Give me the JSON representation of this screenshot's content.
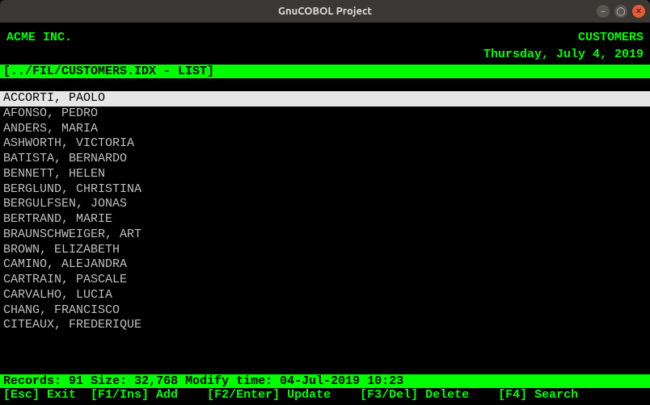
{
  "window": {
    "title": "GnuCOBOL Project"
  },
  "header": {
    "company": "ACME INC.",
    "screen_name": "CUSTOMERS",
    "date": "Thursday, July 4, 2019"
  },
  "path_bar": "[../FIL/CUSTOMERS.IDX - LIST]",
  "records": [
    "ACCORTI, PAOLO",
    "AFONSO, PEDRO",
    "ANDERS, MARIA",
    "ASHWORTH, VICTORIA",
    "BATISTA, BERNARDO",
    "BENNETT, HELEN",
    "BERGLUND, CHRISTINA",
    "BERGULFSEN, JONAS",
    "BERTRAND, MARIE",
    "BRAUNSCHWEIGER, ART",
    "BROWN, ELIZABETH",
    "CAMINO, ALEJANDRA",
    "CARTRAIN, PASCALE",
    "CARVALHO, LUCIA",
    "CHANG, FRANCISCO",
    "CITEAUX, FREDERIQUE"
  ],
  "selected_index": 0,
  "status": {
    "records_label": "Records:",
    "records_count": "91",
    "size_label": "Size:",
    "size_value": "32,768",
    "modify_label": "Modify time:",
    "modify_value": "04-Jul-2019 10:23"
  },
  "fkeys": [
    {
      "key": "[Esc]",
      "label": "Exit"
    },
    {
      "key": "[F1/Ins]",
      "label": "Add"
    },
    {
      "key": "[F2/Enter]",
      "label": "Update"
    },
    {
      "key": "[F3/Del]",
      "label": "Delete"
    },
    {
      "key": "[F4]",
      "label": "Search"
    }
  ]
}
